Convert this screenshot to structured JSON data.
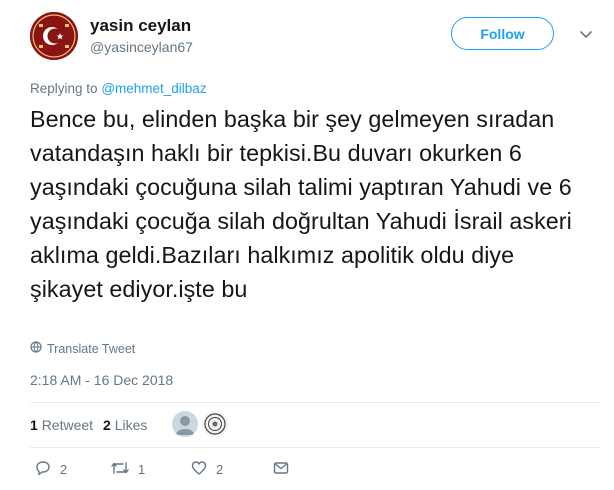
{
  "user": {
    "name": "yasin ceylan",
    "handle": "@yasinceylan67"
  },
  "follow_label": "Follow",
  "replying": {
    "prefix": "Replying to",
    "mention": "@mehmet_dilbaz"
  },
  "tweet": {
    "text": "Bence bu, elinden başka bir şey gelmeyen sıradan vatandaşın haklı bir tepkisi.Bu duvarı okurken 6 yaşındaki çocuğuna silah talimi yaptıran Yahudi ve 6 yaşındaki çocuğa silah doğrultan Yahudi İsrail askeri aklıma geldi.Bazıları halkımız apolitik oldu diye şikayet ediyor.işte bu",
    "translate_label": "Translate Tweet",
    "timestamp": "2:18 AM - 16 Dec 2018"
  },
  "stats": {
    "retweets_count": "1",
    "retweets_label": "Retweet",
    "likes_count": "2",
    "likes_label": "Likes"
  },
  "actions": {
    "reply_count": "2",
    "retweet_count": "1",
    "like_count": "2"
  },
  "colors": {
    "accent": "#1da1f2",
    "secondary_text": "#657786",
    "divider": "#e6ecf0",
    "avatar_bg": "#8a1414"
  },
  "icons": {
    "caret": "chevron-down-icon",
    "translate": "globe-icon",
    "reply": "reply-icon",
    "retweet": "retweet-icon",
    "like": "heart-icon",
    "dm": "message-icon"
  }
}
